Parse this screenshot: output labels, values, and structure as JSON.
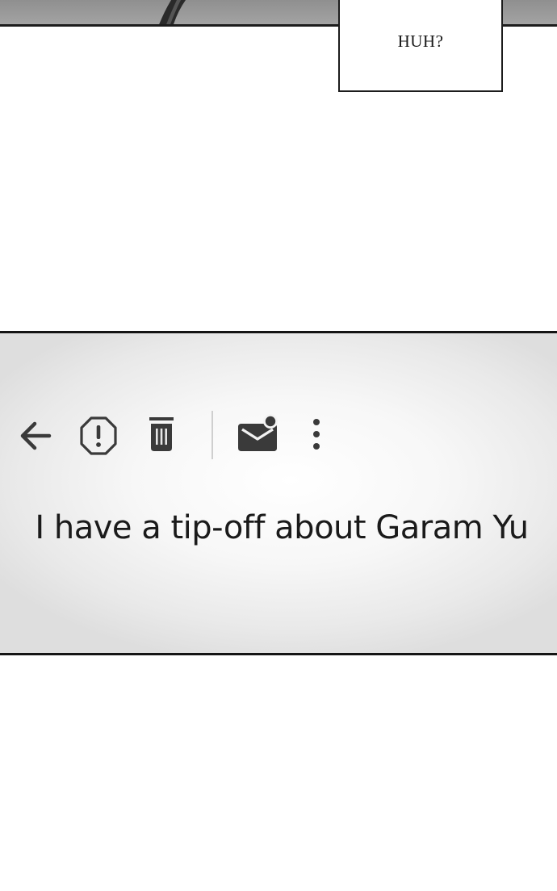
{
  "speech_bubble": {
    "text": "HUH?"
  },
  "email_view": {
    "toolbar": {
      "icons": [
        "back-arrow-icon",
        "report-spam-icon",
        "trash-icon",
        "mark-unread-icon",
        "more-vert-icon"
      ]
    },
    "subject": "I have a tip-off about Garam Yu"
  },
  "colors": {
    "ink": "#1a1a1a",
    "icon": "#3a3a3a",
    "panel_border": "#141414",
    "top_panel": "#9a9a9a"
  }
}
